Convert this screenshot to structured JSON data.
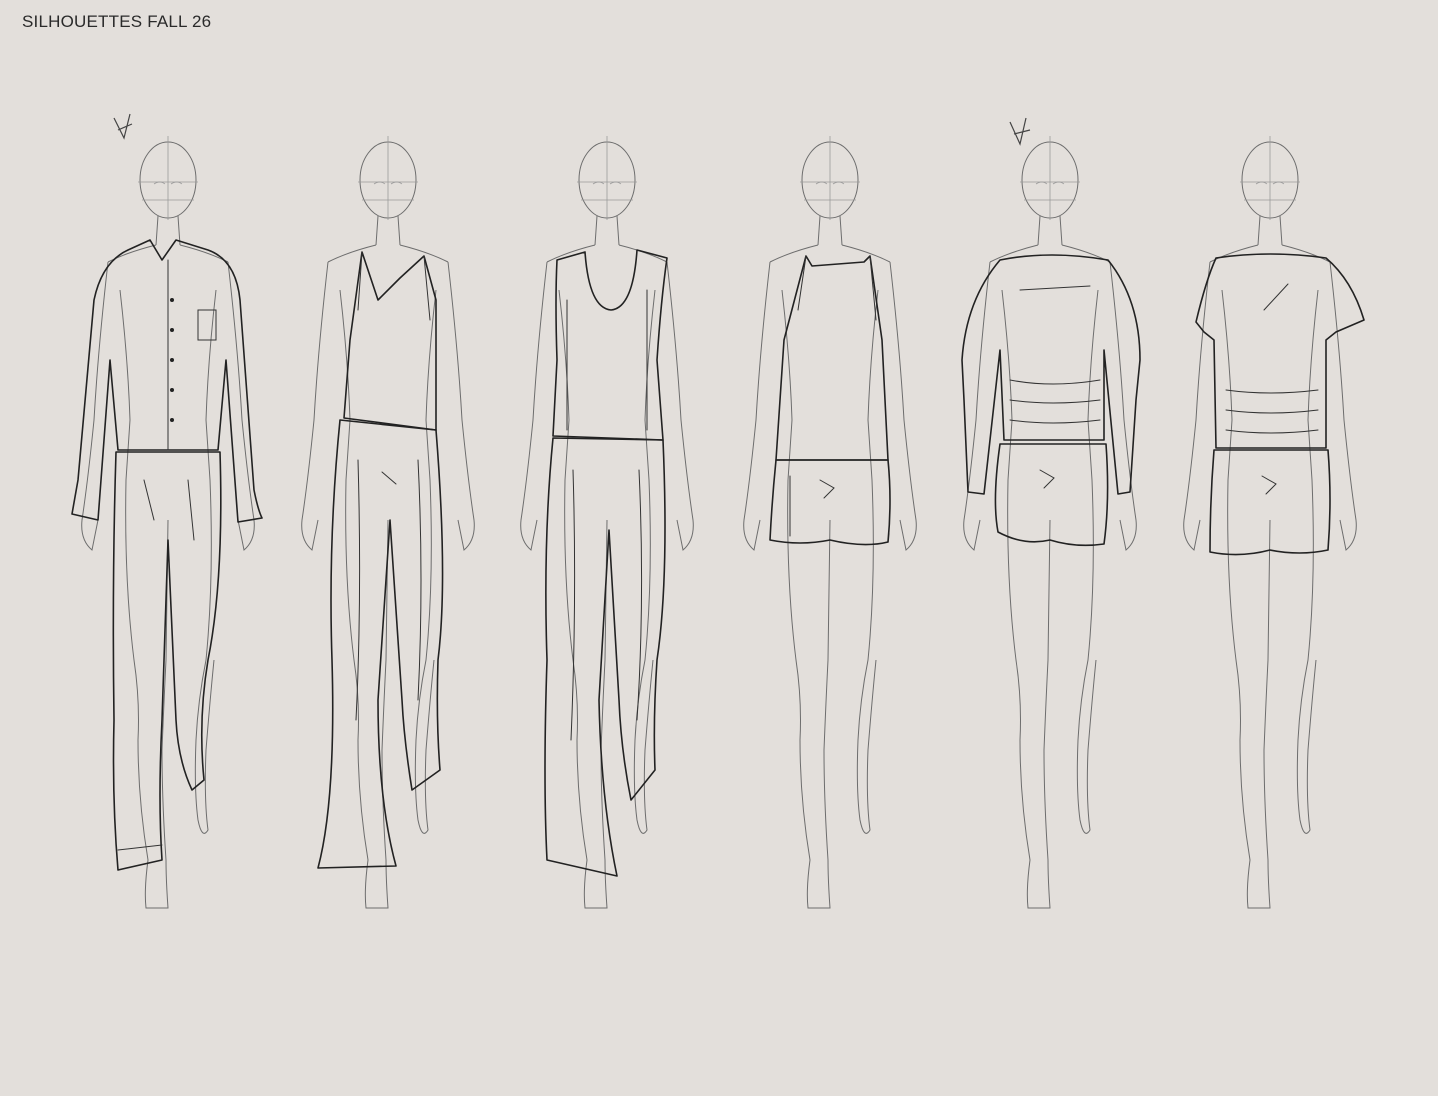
{
  "page": {
    "title": "SILHOUETTES FALL 26"
  },
  "figures": [
    {
      "id": "look-1",
      "outfit": "pajama shirt and trousers",
      "marked": true
    },
    {
      "id": "look-2",
      "outfit": "camisole and wide trousers",
      "marked": false
    },
    {
      "id": "look-3",
      "outfit": "scoop tank and wide trousers",
      "marked": false
    },
    {
      "id": "look-4",
      "outfit": "camisole and shorts",
      "marked": false
    },
    {
      "id": "look-5",
      "outfit": "long sleeve boat neck top and shorts",
      "marked": true
    },
    {
      "id": "look-6",
      "outfit": "short sleeve boat neck top and shorts",
      "marked": false
    }
  ],
  "colors": {
    "background": "#e3dfdb",
    "ink": "#222222",
    "body_line": "#6d6d6d"
  }
}
